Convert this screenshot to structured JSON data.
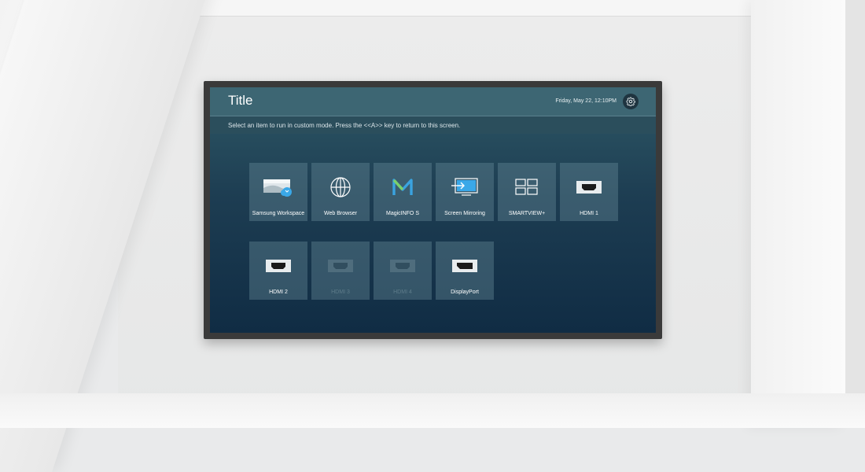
{
  "screen": {
    "title": "Title",
    "datetime": "Friday, May 22, 12:10PM",
    "instructions": "Select an item to run in custom mode. Press the <<A>> key to return to this screen."
  },
  "sources": [
    {
      "label": "Samsung Workspace",
      "icon": "samsung-workspace-icon",
      "enabled": true
    },
    {
      "label": "Web Browser",
      "icon": "globe-icon",
      "enabled": true
    },
    {
      "label": "MagicINFO S",
      "icon": "magicinfo-icon",
      "enabled": true
    },
    {
      "label": "Screen Mirroring",
      "icon": "screen-mirroring-icon",
      "enabled": true
    },
    {
      "label": "SMARTVIEW+",
      "icon": "smartview-icon",
      "enabled": true
    },
    {
      "label": "HDMI 1",
      "icon": "hdmi-icon",
      "enabled": true
    },
    {
      "label": "HDMI 2",
      "icon": "hdmi-icon",
      "enabled": true
    },
    {
      "label": "HDMI 3",
      "icon": "hdmi-icon",
      "enabled": false
    },
    {
      "label": "HDMI 4",
      "icon": "hdmi-icon",
      "enabled": false
    },
    {
      "label": "DisplayPort",
      "icon": "displayport-icon",
      "enabled": true
    }
  ],
  "colors": {
    "accent_magicinfo": "#3aa3e0",
    "accent_cloud": "#3aa8e8"
  }
}
